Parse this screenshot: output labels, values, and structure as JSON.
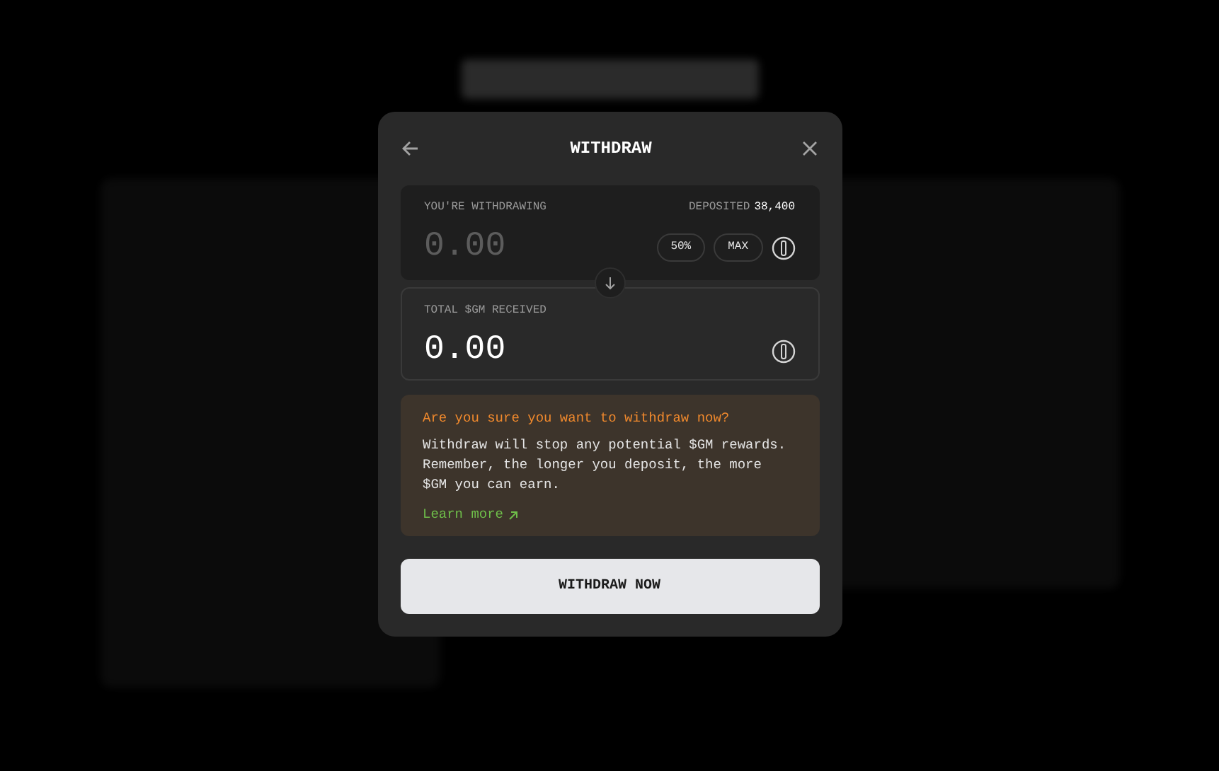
{
  "modal": {
    "title": "WITHDRAW",
    "withdraw_field": {
      "label": "YOU'RE WITHDRAWING",
      "deposited_label": "DEPOSITED",
      "deposited_value": "38,400",
      "placeholder": "0.00",
      "quick_buttons": [
        "50%",
        "MAX"
      ]
    },
    "received_field": {
      "label": "TOTAL $GM RECEIVED",
      "value": "0.00"
    },
    "warning": {
      "title": "Are you sure you want to withdraw now?",
      "body": "Withdraw will stop any potential $GM rewards. Remember, the longer you deposit, the more $GM you can earn.",
      "link": "Learn more"
    },
    "submit": "WITHDRAW NOW"
  }
}
